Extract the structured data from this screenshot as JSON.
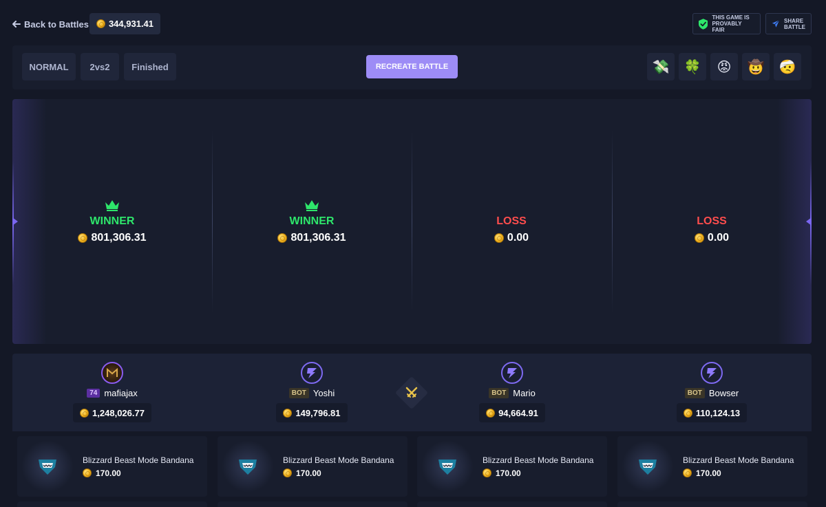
{
  "header": {
    "back_label": "Back to Battles",
    "balance": "344,931.41",
    "provably_fair_label": "THIS GAME IS PROVABLY FAIR",
    "share_label": "SHARE BATTLE"
  },
  "controls": {
    "mode": "NORMAL",
    "team_format": "2vs2",
    "status": "Finished",
    "recreate_label": "RECREATE BATTLE",
    "emojis": [
      {
        "icon": "money-with-wings-icon",
        "glyph": "💸"
      },
      {
        "icon": "four-leaf-clover-icon",
        "glyph": "🍀"
      },
      {
        "icon": "angry-face-icon",
        "glyph": "😡"
      },
      {
        "icon": "cowboy-face-icon",
        "glyph": "🤠"
      },
      {
        "icon": "bandaged-face-icon",
        "glyph": "🤕"
      }
    ]
  },
  "results": [
    {
      "outcome": "WINNER",
      "amount": "801,306.31"
    },
    {
      "outcome": "WINNER",
      "amount": "801,306.31"
    },
    {
      "outcome": "LOSS",
      "amount": "0.00"
    },
    {
      "outcome": "LOSS",
      "amount": "0.00"
    }
  ],
  "players": [
    {
      "name": "mafiajax",
      "badge": "74",
      "badge_type": "level",
      "total": "1,248,026.77"
    },
    {
      "name": "Yoshi",
      "badge": "BOT",
      "badge_type": "bot",
      "total": "149,796.81"
    },
    {
      "name": "Mario",
      "badge": "BOT",
      "badge_type": "bot",
      "total": "94,664.91"
    },
    {
      "name": "Bowser",
      "badge": "BOT",
      "badge_type": "bot",
      "total": "110,124.13"
    }
  ],
  "items": [
    {
      "name": "Blizzard Beast Mode Bandana",
      "price": "170.00"
    },
    {
      "name": "Blizzard Beast Mode Bandana",
      "price": "170.00"
    },
    {
      "name": "Blizzard Beast Mode Bandana",
      "price": "170.00"
    },
    {
      "name": "Blizzard Beast Mode Bandana",
      "price": "170.00"
    }
  ],
  "colors": {
    "background": "#141826",
    "panel": "#181d2d",
    "accent": "#9d8cf6",
    "win": "#2ee66b",
    "loss": "#ff4d4d",
    "coin": "#f2b420"
  }
}
